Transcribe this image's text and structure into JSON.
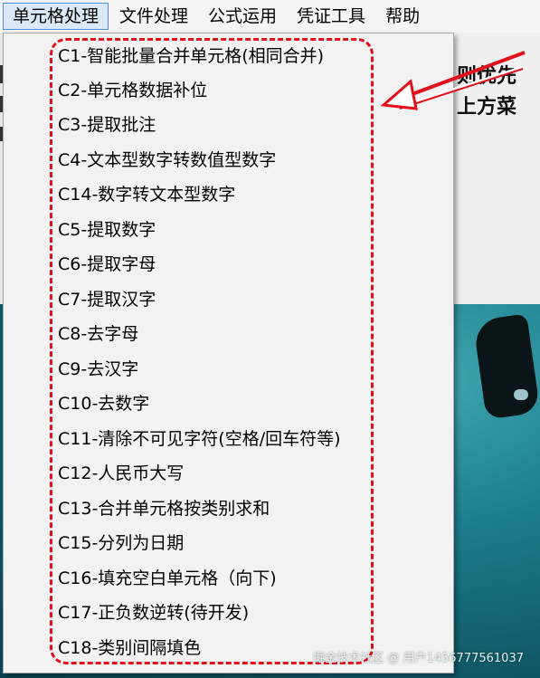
{
  "menubar": {
    "items": [
      "单元格处理",
      "文件处理",
      "公式运用",
      "凭证工具",
      "帮助"
    ]
  },
  "background": {
    "right_text_lines": [
      "则优先",
      "上方菜"
    ]
  },
  "dropdown": {
    "items": [
      "C1-智能批量合并单元格(相同合并)",
      "C2-单元格数据补位",
      "C3-提取批注",
      "C4-文本型数字转数值型数字",
      "C14-数字转文本型数字",
      "C5-提取数字",
      "C6-提取字母",
      "C7-提取汉字",
      "C8-去字母",
      "C9-去汉字",
      "C10-去数字",
      "C11-清除不可见字符(空格/回车符等)",
      "C12-人民币大写",
      "C13-合并单元格按类别求和",
      "C15-分列为日期",
      "C16-填充空白单元格（向下)",
      "C17-正负数逆转(待开发)",
      "C18-类别间隔填色"
    ]
  },
  "watermark": "掘金技术社区 @ 用户1456777561037",
  "colors": {
    "annotation": "#e3101b",
    "menu_active_bg": "#dbe8f7",
    "menu_active_border": "#4a90d9",
    "menu_bg": "#f2f2f2"
  }
}
